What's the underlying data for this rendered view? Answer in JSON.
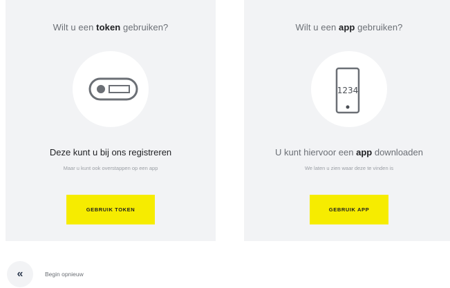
{
  "token_card": {
    "title_before": "Wilt u een ",
    "title_bold": "token",
    "title_after": " gebruiken?",
    "icon": "token-device-icon",
    "headline": "Deze kunt u bij ons registreren",
    "subline": "Maar u kunt ook overstappen op een app",
    "button_label": "GEBRUIK TOKEN"
  },
  "app_card": {
    "title_before": "Wilt u een ",
    "title_bold": "app",
    "title_after": " gebruiken?",
    "icon": "smartphone-icon",
    "phone_code": "1234",
    "headline_before": "U kunt hiervoor een ",
    "headline_bold": "app",
    "headline_after": " downloaden",
    "subline": "We laten u zien waar deze te vinden is",
    "button_label": "GEBRUIK APP"
  },
  "restart": {
    "icon": "double-chevron-left-icon",
    "glyph": "«",
    "label": "Begin opnieuw"
  },
  "colors": {
    "card_bg": "#f2f3f5",
    "accent_yellow": "#f6ec00",
    "text_dark": "#1e1f22",
    "text_grey": "#6b6f75"
  }
}
